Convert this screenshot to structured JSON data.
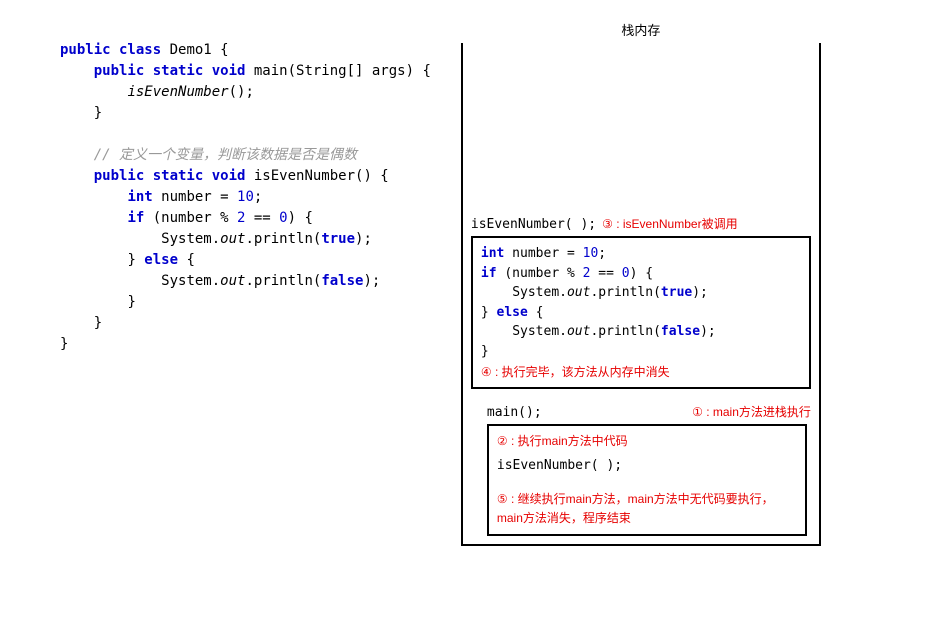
{
  "left": {
    "l1_kw1": "public class",
    "l1_name": " Demo1 {",
    "l2_kw": "public static void",
    "l2_sig": " main(String[] args) {",
    "l3_call": "isEvenNumber",
    "l3_end": "();",
    "l4": "}",
    "comment": "// 定义一个变量，判断该数据是否是偶数",
    "l5_kw": "public static void",
    "l5_sig": " isEvenNumber() {",
    "l6_kw": "int",
    "l6_rest": " number = ",
    "l6_num": "10",
    "l6_semi": ";",
    "l7_kw": "if",
    "l7_a": " (number % ",
    "l7_n2": "2",
    "l7_b": " == ",
    "l7_n0": "0",
    "l7_c": ") {",
    "l8_a": "System.",
    "l8_out": "out",
    "l8_b": ".println(",
    "l8_true": "true",
    "l8_c": ");",
    "l9_a": "} ",
    "l9_kw": "else",
    "l9_b": " {",
    "l10_a": "System.",
    "l10_out": "out",
    "l10_b": ".println(",
    "l10_false": "false",
    "l10_c": ");",
    "l11": "}",
    "l12": "}",
    "l13": "}"
  },
  "stack": {
    "title": "栈内存",
    "frame1_label": "isEvenNumber( );",
    "anno3_circ": "③",
    "anno3_txt": " : isEvenNumber被调用",
    "body_int": "int",
    "body_l1a": " number = ",
    "body_l1num": "10",
    "body_l1b": ";",
    "body_if": "if",
    "body_l2a": " (number % ",
    "body_l2n2": "2",
    "body_l2b": " == ",
    "body_l2n0": "0",
    "body_l2c": ") {",
    "body_l3a": "System.",
    "body_l3out": "out",
    "body_l3b": ".println(",
    "body_l3true": "true",
    "body_l3c": ");",
    "body_l4a": "} ",
    "body_else": "else",
    "body_l4b": " {",
    "body_l5a": "System.",
    "body_l5out": "out",
    "body_l5b": ".println(",
    "body_l5false": "false",
    "body_l5c": ");",
    "body_l6": "}",
    "anno4_circ": "④",
    "anno4_txt": " : 执行完毕，该方法从内存中消失",
    "main_label": "main();",
    "anno1_circ": "①",
    "anno1_txt": " : main方法进栈执行",
    "anno2_circ": "②",
    "anno2_txt": " : 执行main方法中代码",
    "main_body_call": "isEvenNumber( );",
    "anno5_circ": "⑤",
    "anno5_txt": " : 继续执行main方法，main方法中无代码要执行，main方法消失，程序结束"
  }
}
